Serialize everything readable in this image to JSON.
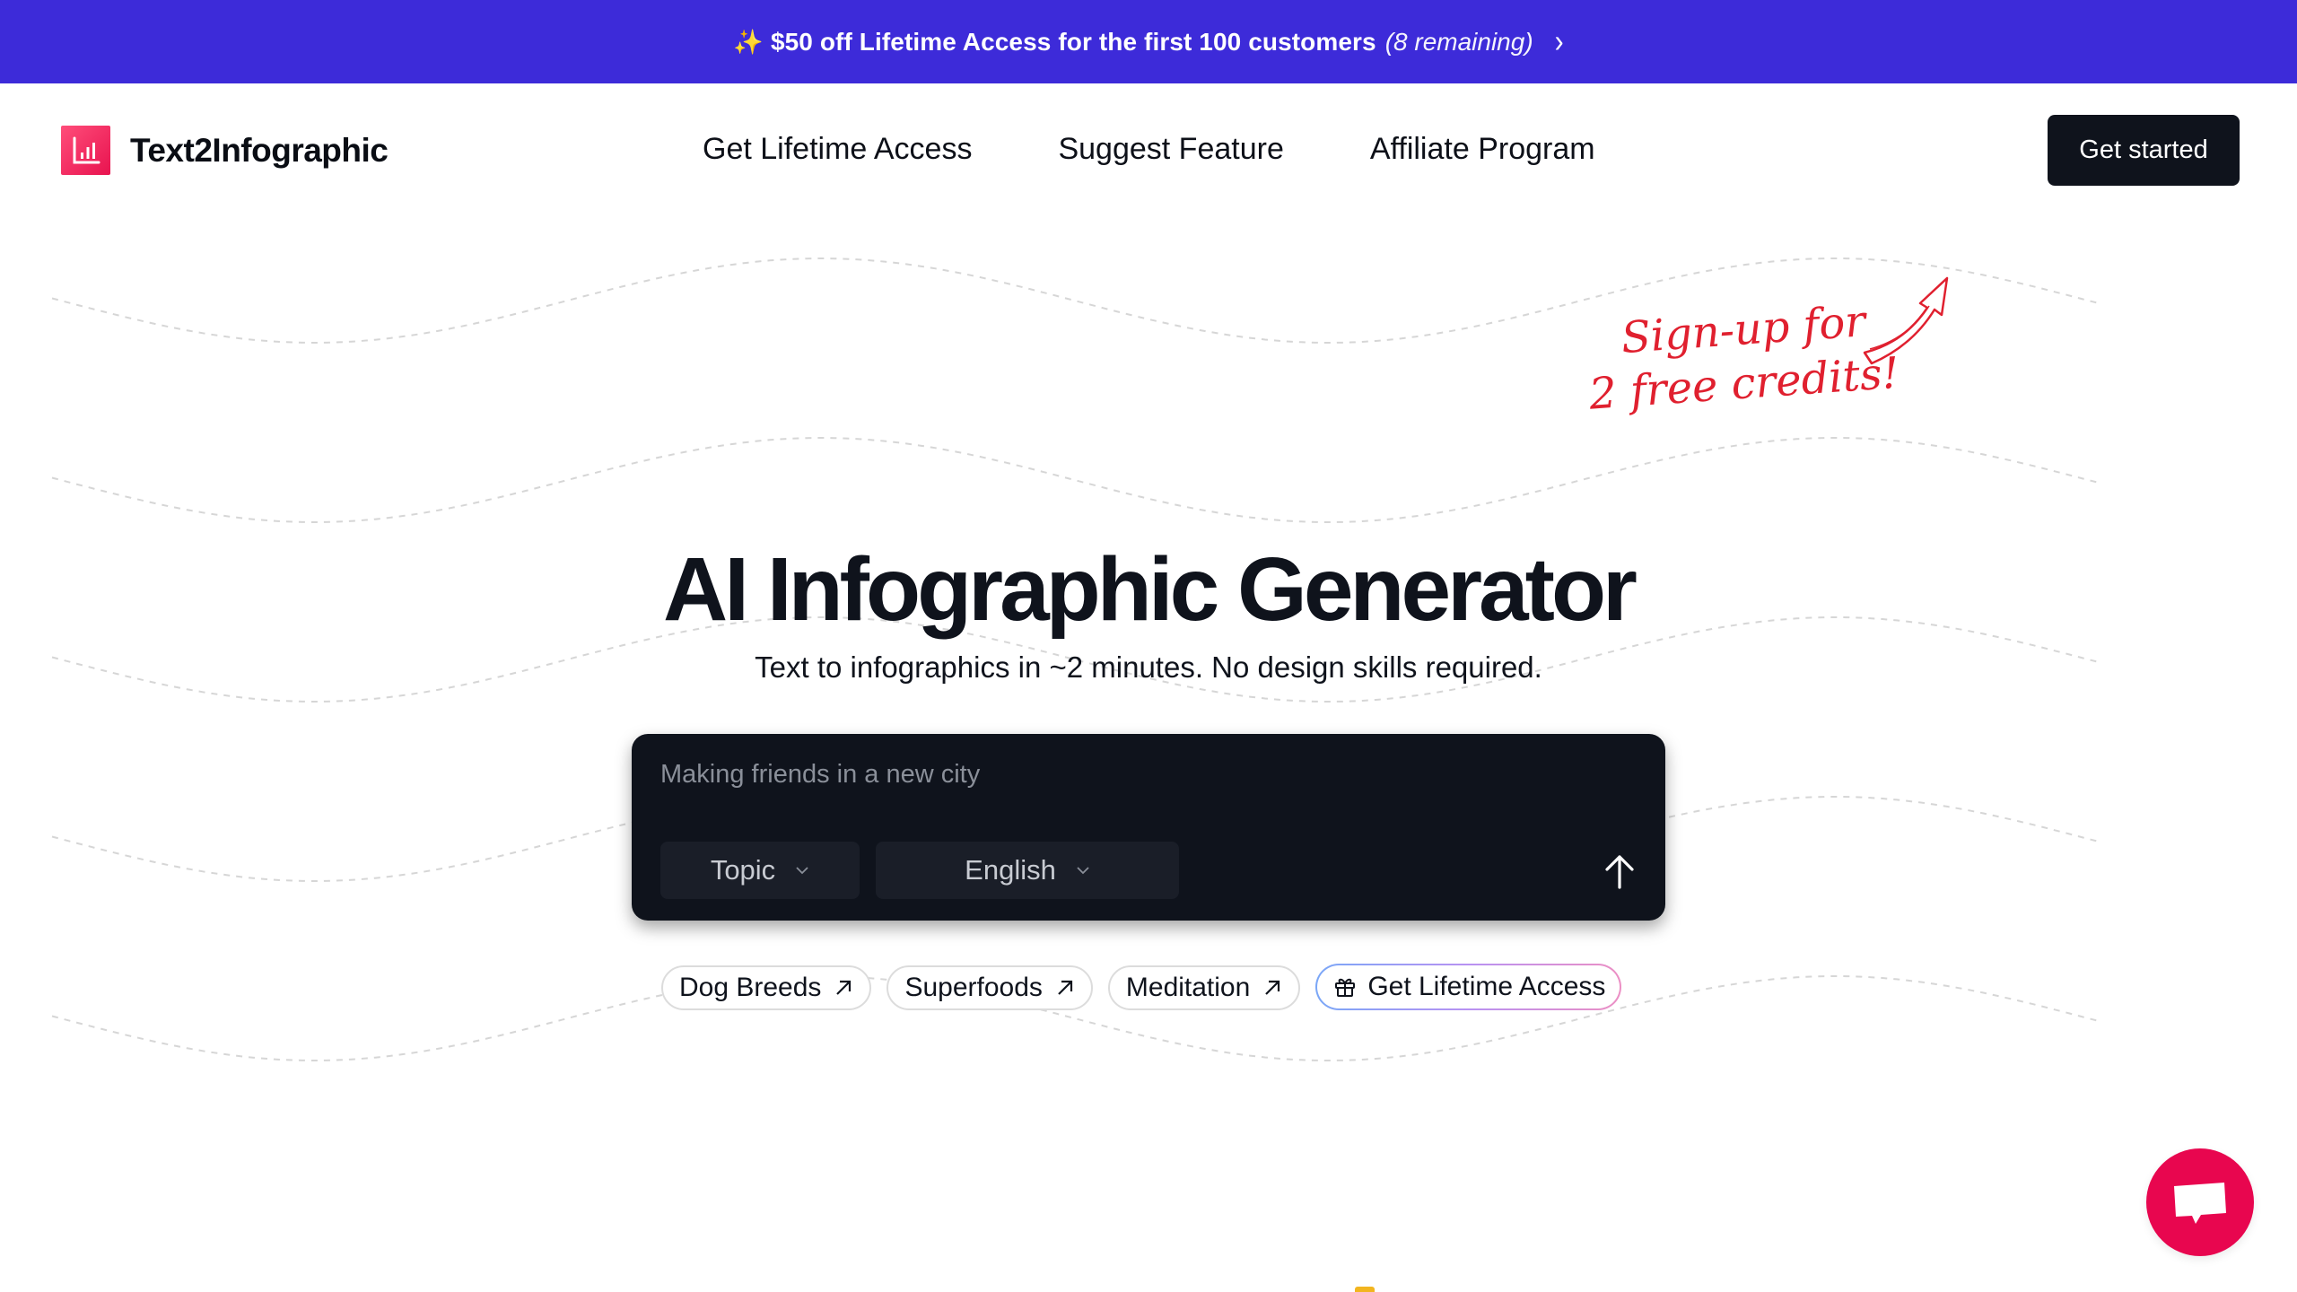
{
  "promo": {
    "emoji": "✨",
    "text": "$50 off Lifetime Access for the first 100 customers",
    "remaining": "(8 remaining)",
    "chevron": "›",
    "icon": "sparkles-icon",
    "background_color": "#3d2bd9"
  },
  "header": {
    "brand": "Text2Infographic",
    "logo_icon": "bar-chart-icon",
    "nav": [
      {
        "label": "Get Lifetime Access"
      },
      {
        "label": "Suggest Feature"
      },
      {
        "label": "Affiliate Program"
      }
    ],
    "cta_label": "Get started"
  },
  "annotation": {
    "line1": "Sign-up for",
    "line2": "2 free credits!",
    "color": "#e0202f",
    "icon": "curved-arrow-icon"
  },
  "hero": {
    "title": "AI Infographic Generator",
    "subtitle": "Text to infographics in ~2 minutes. No design skills required."
  },
  "prompt": {
    "placeholder": "Making friends in a new city",
    "value": "",
    "type_select": {
      "selected": "Topic"
    },
    "language_select": {
      "selected": "English"
    },
    "submit_icon": "arrow-up-icon"
  },
  "chips": [
    {
      "label": "Dog Breeds",
      "icon": "arrow-up-right-icon"
    },
    {
      "label": "Superfoods",
      "icon": "arrow-up-right-icon"
    },
    {
      "label": "Meditation",
      "icon": "arrow-up-right-icon"
    }
  ],
  "lifetime_chip": {
    "label": "Get Lifetime Access",
    "icon": "gift-icon"
  },
  "chat_widget": {
    "icon": "chat-bubble-icon",
    "color": "#e8064f"
  }
}
